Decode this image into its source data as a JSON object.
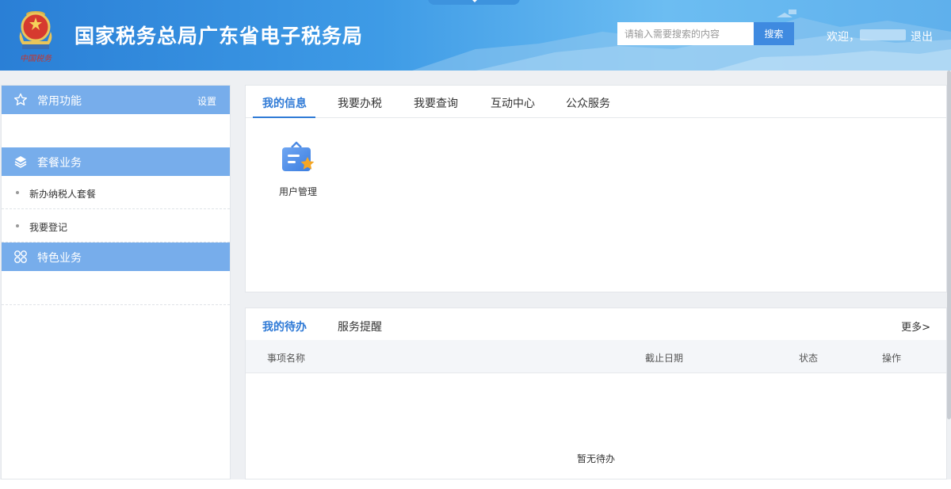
{
  "header": {
    "title": "国家税务总局广东省电子税务局",
    "emblem_caption": "中国税务",
    "search": {
      "placeholder": "请输入需要搜索的内容",
      "value": "",
      "button_label": "搜索"
    },
    "welcome": "欢迎，",
    "logout": "退出"
  },
  "sidebar": {
    "common": {
      "label": "常用功能",
      "settings": "设置",
      "icon": "star-icon"
    },
    "package": {
      "label": "套餐业务",
      "icon": "layers-icon",
      "items": [
        {
          "label": "新办纳税人套餐"
        },
        {
          "label": "我要登记"
        }
      ]
    },
    "special": {
      "label": "特色业务",
      "icon": "grid-icon"
    }
  },
  "main_tabs": {
    "tabs": [
      {
        "label": "我的信息",
        "active": true
      },
      {
        "label": "我要办税",
        "active": false
      },
      {
        "label": "我要查询",
        "active": false
      },
      {
        "label": "互动中心",
        "active": false
      },
      {
        "label": "公众服务",
        "active": false
      }
    ],
    "apps": [
      {
        "label": "用户管理",
        "icon": "user-management-icon"
      }
    ]
  },
  "todo": {
    "tabs": [
      {
        "label": "我的待办",
        "active": true
      },
      {
        "label": "服务提醒",
        "active": false
      }
    ],
    "more": "更多>",
    "columns": {
      "name": "事项名称",
      "deadline": "截止日期",
      "status": "状态",
      "action": "操作"
    },
    "empty": "暂无待办"
  },
  "colors": {
    "accent": "#2f7ad6",
    "sidebar_header": "#77adeb",
    "header_blue": "#2a7fd6"
  }
}
